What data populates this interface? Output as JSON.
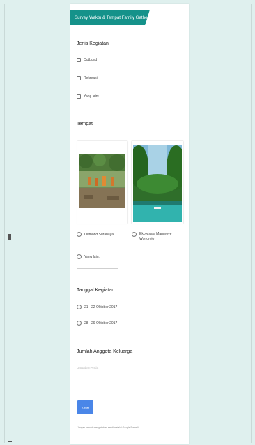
{
  "form": {
    "title": "Survey Waktu & Tempat Family Gathering",
    "sections": {
      "jenis": {
        "title": "Jenis Kegiatan",
        "options": [
          "Outbond",
          "Rekreasi",
          "Yang lain:"
        ]
      },
      "tempat": {
        "title": "Tempat",
        "options": [
          "Outbond Surabaya",
          "Ekowisata Mangrove Wonorejo",
          "Yang lain:"
        ]
      },
      "tanggal": {
        "title": "Tanggal Kegiatan",
        "options": [
          "21 - 22 Oktober 2017",
          "28 - 29 Oktober 2017"
        ]
      },
      "jumlah": {
        "title": "Jumlah Anggota Keluarga",
        "placeholder": "Jawaban Anda"
      }
    },
    "submit_label": "KIRIM",
    "footer": "Jangan pernah mengirimkan sandi melalui Google Formulir."
  },
  "colors": {
    "banner": "#15928a",
    "button": "#4a86e8",
    "background": "#dff0ee"
  }
}
